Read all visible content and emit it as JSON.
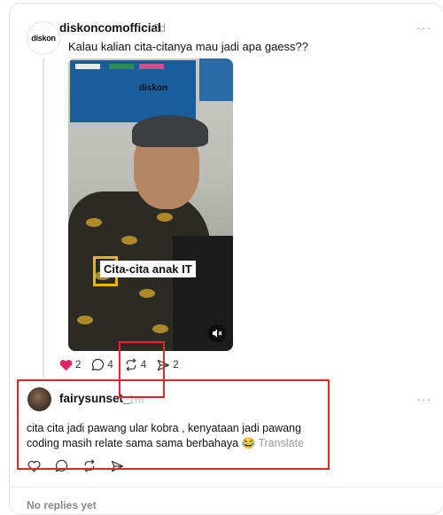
{
  "post": {
    "avatar_logo": "diskon",
    "username": "diskoncomofficial",
    "time": "2d",
    "more": "···",
    "text": "Kalau kalian cita-citanya mau jadi apa gaess??",
    "media": {
      "logo": "diskon",
      "caption": "Cita-cita anak IT",
      "mute_icon": "mute-icon"
    },
    "actions": {
      "likes": "2",
      "comments": "4",
      "reposts": "4",
      "shares": "2"
    }
  },
  "reply": {
    "username": "fairysunset_",
    "time": "1m",
    "more": "···",
    "text": "cita cita jadi pawang ular kobra , kenyataan jadi pawang coding masih relate sama sama berbahaya 😂",
    "translate": "Translate"
  },
  "footer": {
    "no_replies": "No replies yet"
  },
  "colors": {
    "like": "#e0245e",
    "highlight": "#e2262b",
    "muted": "#999999"
  }
}
